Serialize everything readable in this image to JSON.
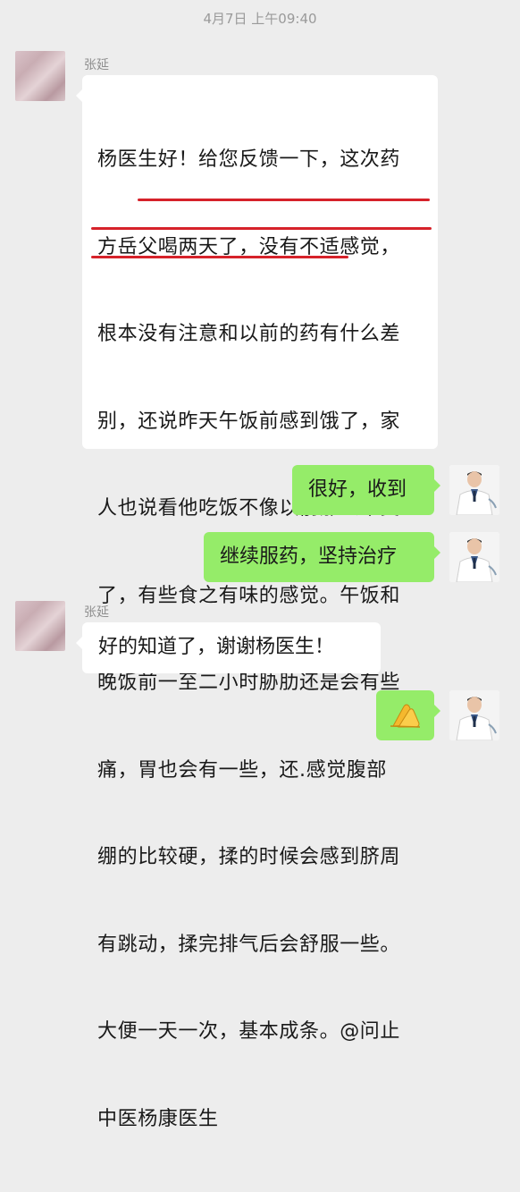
{
  "timestamp": "4月7日 上午09:40",
  "messages": [
    {
      "side": "left",
      "sender": "张延",
      "lines": [
        "杨医生好！给您反馈一下，这次药",
        "方岳父喝两天了，没有不适感觉，",
        "根本没有注意和以前的药有什么差",
        "别，还说昨天午饭前感到饿了，家",
        "人也说看他吃饭不像以前那么难受",
        "了，有些食之有味的感觉。午饭和",
        "晚饭前一至二小时胁肋还是会有些",
        "痛，胃也会有一些，还.感觉腹部",
        "绷的比较硬，揉的时候会感到脐周",
        "有跳动，揉完排气后会舒服一些。",
        "大便一天一次，基本成条。@问止",
        "中医杨康医生"
      ]
    },
    {
      "side": "right",
      "text": "很好，收到"
    },
    {
      "side": "right",
      "text": "继续服药，坚持治疗"
    },
    {
      "side": "left",
      "sender": "张延",
      "text": "好的知道了，谢谢杨医生！"
    },
    {
      "side": "right",
      "emoji": "clapping-hands"
    }
  ],
  "colors": {
    "background": "#ededed",
    "bubble_self": "#95ec69",
    "bubble_other": "#ffffff",
    "highlight_underline": "#d6222a"
  }
}
